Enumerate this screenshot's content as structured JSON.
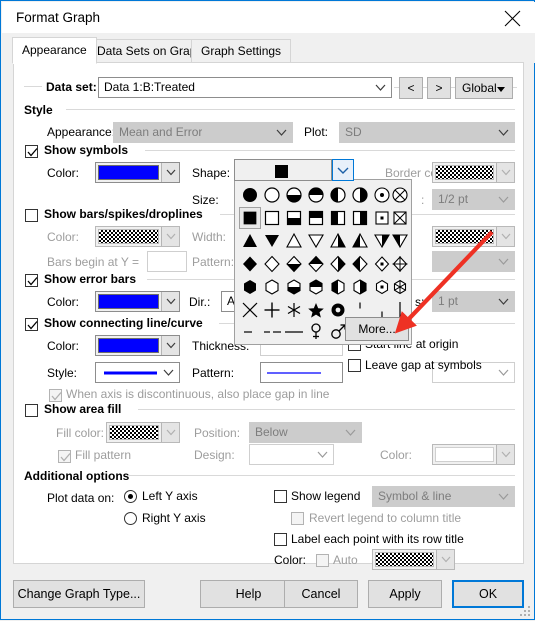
{
  "window": {
    "title": "Format Graph",
    "close_icon": "close-icon"
  },
  "tabs": [
    {
      "label": "Appearance",
      "active": true
    },
    {
      "label": "Data Sets on Graph",
      "active": false
    },
    {
      "label": "Graph Settings",
      "active": false
    }
  ],
  "dataset": {
    "label": "Data set:",
    "value": "Data 1:B:Treated",
    "prev_label": "<",
    "next_label": ">",
    "scope_label": "Global"
  },
  "style": {
    "group_label": "Style",
    "appearance_label": "Appearance:",
    "appearance_value": "Mean and Error",
    "plot_label": "Plot:",
    "plot_value": "SD"
  },
  "symbols": {
    "group_label": "Show symbols",
    "checked": true,
    "color_label": "Color:",
    "color_value": "#0000ff",
    "shape_label": "Shape:",
    "shape_value": "filled-square",
    "size_label": "Size:",
    "border_color_label": "Border color:",
    "border_color_value": "none-checker",
    "border_thickness_value": "1/2 pt"
  },
  "palette": {
    "selected_index": 8,
    "more_label": "More...",
    "glyphs": [
      "circle-filled",
      "circle-open",
      "circle-bottom-half",
      "circle-top-half",
      "circle-left-half",
      "circle-right-half",
      "circle-dot",
      "circle-x",
      "square-filled",
      "square-open",
      "square-bottom-half",
      "square-top-half",
      "square-left-half",
      "square-right-half",
      "square-dot",
      "square-x",
      "triangle-up-filled",
      "triangle-down-filled",
      "triangle-up-open",
      "triangle-down-open",
      "triangle-up-left-half",
      "triangle-up-right-half",
      "triangle-down-left-half",
      "triangle-down-right-half",
      "diamond-filled",
      "diamond-open",
      "diamond-bottom-half",
      "diamond-top-half",
      "diamond-left-half",
      "diamond-right-half",
      "diamond-dot",
      "diamond-cross",
      "hexagon-filled",
      "hexagon-open",
      "hexagon-bottom-half",
      "hexagon-top-half",
      "hexagon-left-half",
      "hexagon-right-half",
      "hexagon-dot",
      "hexagon-cross",
      "x-mark",
      "plus-mark",
      "asterisk-mark",
      "star-filled",
      "donut-filled",
      "tick-upper",
      "tick-lower",
      "tick-full",
      "dash-short",
      "dash-dashed",
      "dash-long",
      "venus-symbol",
      "mars-symbol"
    ]
  },
  "bars": {
    "group_label": "Show bars/spikes/droplines",
    "checked": false,
    "color_label": "Color:",
    "color_value": "none-checker",
    "width_label": "Width:",
    "begin_label": "Bars begin at Y =",
    "begin_value": "",
    "pattern_label": "Pattern:"
  },
  "errorbars": {
    "group_label": "Show error bars",
    "checked": true,
    "color_label": "Color:",
    "color_value": "#0000ff",
    "dir_label": "Dir.:",
    "dir_value": "Above",
    "thickness_label": "s:",
    "thickness_value": "1 pt"
  },
  "connecting": {
    "group_label": "Show connecting line/curve",
    "checked": true,
    "color_label": "Color:",
    "color_value": "#0000ff",
    "thickness_label": "Thickness:",
    "style_label": "Style:",
    "pattern_label": "Pattern:",
    "gap_label": "When axis is discontinuous, also place gap in line",
    "gap_checked": true,
    "start_origin_label": "Start line at origin",
    "start_origin_checked": false,
    "leave_gap_label": "Leave gap at symbols",
    "leave_gap_checked": false
  },
  "areafill": {
    "group_label": "Show area fill",
    "checked": false,
    "fill_color_label": "Fill color:",
    "fill_color_value": "none-checker",
    "position_label": "Position:",
    "position_value": "Below",
    "fill_pattern_label": "Fill pattern",
    "fill_pattern_checked": true,
    "design_label": "Design:",
    "design_value": "",
    "color_label": "Color:",
    "color_value": "none-checker"
  },
  "additional": {
    "group_label": "Additional options",
    "plot_data_on_label": "Plot data on:",
    "left_axis_label": "Left Y axis",
    "right_axis_label": "Right  Y axis",
    "axis_selected": "left",
    "show_legend_label": "Show legend",
    "show_legend_checked": false,
    "legend_mode_value": "Symbol & line",
    "revert_legend_label": "Revert legend to column title",
    "revert_legend_checked": false,
    "label_points_label": "Label each point with its row title",
    "label_points_checked": false,
    "color_label": "Color:",
    "auto_label": "Auto",
    "auto_checked": false,
    "auto_color_value": "none-checker"
  },
  "footer": {
    "change_graph_type": "Change Graph Type...",
    "help": "Help",
    "cancel": "Cancel",
    "apply": "Apply",
    "ok": "OK"
  },
  "annotation": {
    "arrow_color": "#ee3124"
  }
}
